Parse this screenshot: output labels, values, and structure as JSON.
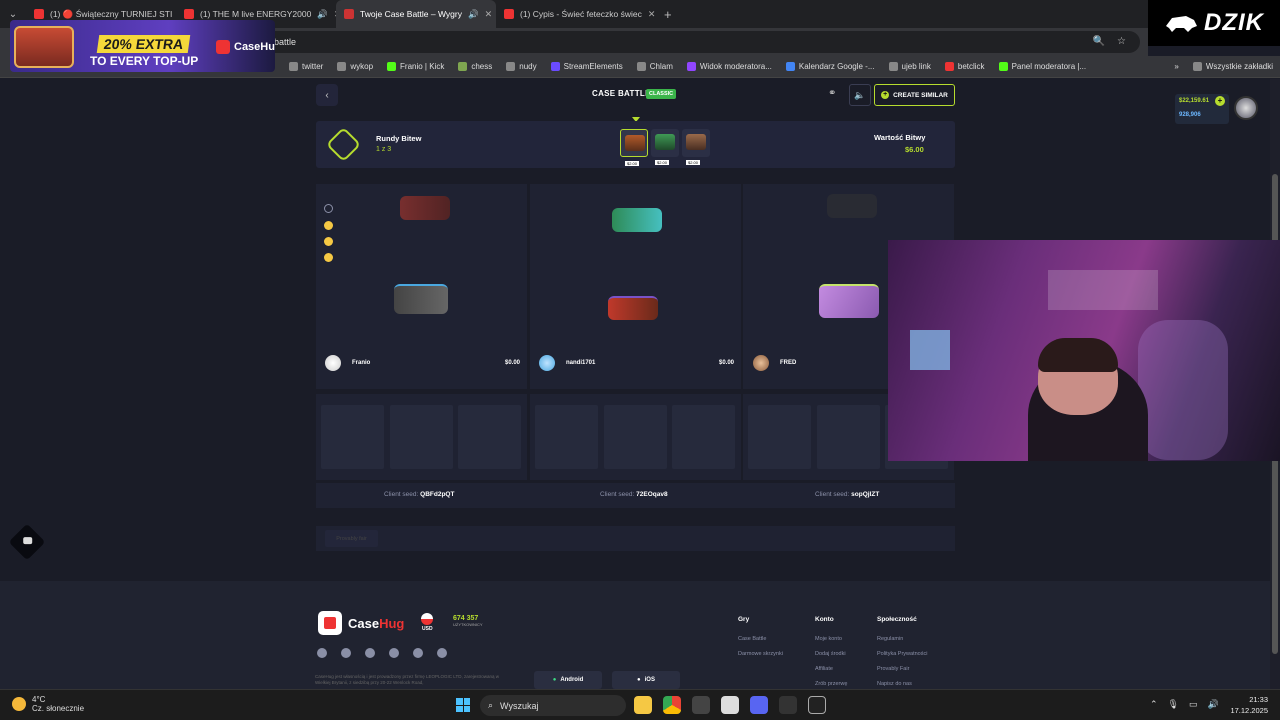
{
  "browser": {
    "tabs": [
      {
        "label": "(1) 🔴 Świąteczny TURNIEJ STI",
        "active": false
      },
      {
        "label": "(1) THE M live ENERGY2000",
        "active": false
      },
      {
        "label": "Twoje Case Battle – Wygry",
        "active": true
      },
      {
        "label": "(1) Cypis - Świeć feteczko świec",
        "active": false
      }
    ],
    "address": "battle",
    "bookmarks": [
      "twitter",
      "wykop",
      "Franio | Kick",
      "chess",
      "nudy",
      "StreamElements",
      "Chlam",
      "Widok moderatora...",
      "Kalendarz Google -...",
      "ujeb link",
      "betclick",
      "Panel moderatora |..."
    ],
    "all_bookmarks": "Wszystkie zakładki"
  },
  "overlay": {
    "brand": "DZIK",
    "ad_line1": "20% EXTRA",
    "ad_line2": "TO EVERY TOP-UP",
    "ad_logo": "CaseHug"
  },
  "header": {
    "title": "CASE BATTLE",
    "badge": "CLASSIC",
    "create_label": "CREATE SIMILAR"
  },
  "wallet": {
    "balance": "$22,159.61",
    "coins": "928,906"
  },
  "rounds": {
    "title": "Rundy Bitew",
    "count": "1 z 3",
    "value_label": "Wartość Bitwy",
    "value": "$6.00",
    "case_prices": [
      "$2.00",
      "$2.00",
      "$2.00"
    ]
  },
  "players": [
    {
      "name": "Franio",
      "value": "$0.00",
      "seed_label": "Client seed:",
      "seed": "QBFd2pQT"
    },
    {
      "name": "nandi1701",
      "value": "$0.00",
      "seed_label": "Client seed:",
      "seed": "72EOqav8"
    },
    {
      "name": "FRED",
      "value": "",
      "seed_label": "Client seed:",
      "seed": "sopQjIZT"
    }
  ],
  "bottom_button": "Provably fair",
  "footer": {
    "brand": "Case",
    "brand_accent": "Hug",
    "currency": "USD",
    "user_count": "674 357",
    "user_label": "UŻYTKOWNICY",
    "legal": "CaseHug jest własnością i jest prowadzony przez firmę LEOPLOGIC LTD, zarejestrowaną w Wielkiej Brytanii, z siedzibą przy 20-22 Wenlock Road,",
    "android": "Android",
    "ios": "iOS",
    "cols": [
      {
        "title": "Gry",
        "items": [
          "Case Battle",
          "Darmowe skrzynki"
        ]
      },
      {
        "title": "Konto",
        "items": [
          "Moje konto",
          "Dodaj środki",
          "Affiliate",
          "Zrób przerwę"
        ]
      },
      {
        "title": "Społeczność",
        "items": [
          "Regulamin",
          "Polityka Prywatności",
          "Provably Fair",
          "Napisz do nas"
        ]
      }
    ]
  },
  "taskbar": {
    "temp": "4°C",
    "weather": "Cz. słonecznie",
    "search": "Wyszukaj",
    "time": "21:33",
    "date": "17.12.2025"
  },
  "colors": {
    "accent": "#b6dc2e",
    "brand_red": "#e33333",
    "bg": "#1a1c27"
  }
}
